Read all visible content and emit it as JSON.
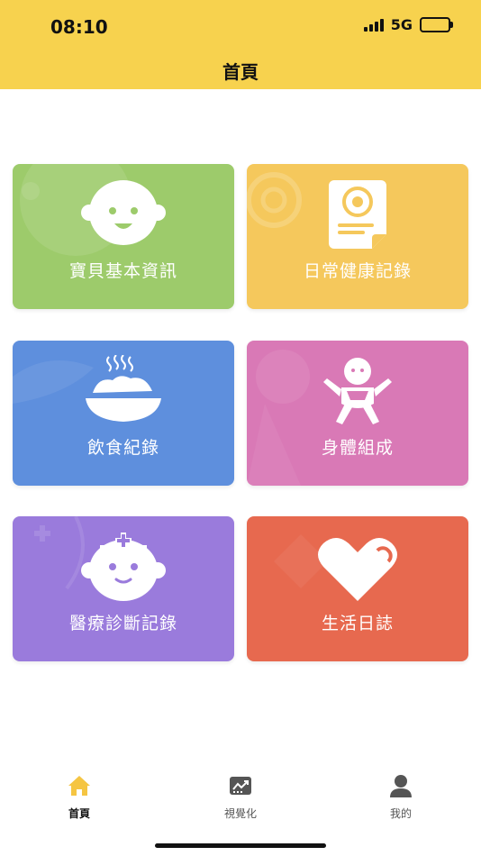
{
  "status": {
    "time": "08:10",
    "network": "5G"
  },
  "header": {
    "title": "首頁",
    "background": "#F7D24E"
  },
  "cards": [
    {
      "label": "寶貝基本資訊",
      "icon": "baby-face-icon",
      "color": "#9DCB6B"
    },
    {
      "label": "日常健康記錄",
      "icon": "health-document-icon",
      "color": "#F5C85C"
    },
    {
      "label": "飲食紀錄",
      "icon": "food-bowl-icon",
      "color": "#5E8FDD"
    },
    {
      "label": "身體組成",
      "icon": "baby-body-icon",
      "color": "#D979B6"
    },
    {
      "label": "醫療診斷記錄",
      "icon": "nurse-baby-icon",
      "color": "#9A7BDC"
    },
    {
      "label": "生活日誌",
      "icon": "heart-icon",
      "color": "#E7694F"
    }
  ],
  "tabbar": {
    "items": [
      {
        "label": "首頁",
        "icon": "home-icon",
        "active": true,
        "active_color": "#F5C542"
      },
      {
        "label": "視覺化",
        "icon": "chart-icon",
        "active": false
      },
      {
        "label": "我的",
        "icon": "user-icon",
        "active": false
      }
    ]
  }
}
